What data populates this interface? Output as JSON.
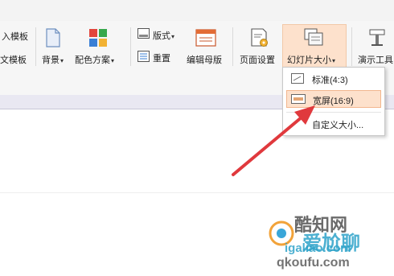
{
  "ribbon": {
    "import_template_partial": "入模板",
    "text_template_partial": "文模板",
    "background": "背景",
    "color_scheme": "配色方案",
    "layout": "版式",
    "reset": "重置",
    "edit_master": "编辑母版",
    "page_setup": "页面设置",
    "slide_size": "幻灯片大小",
    "presentation_tools": "演示工具"
  },
  "slide_size_menu": {
    "items": [
      {
        "label": "标准(4:3)",
        "selected": false
      },
      {
        "label": "宽屏(16:9)",
        "selected": true
      },
      {
        "label": "自定义大小..."
      }
    ]
  },
  "watermark": {
    "line1": "酷知网",
    "line2": "爱尬聊",
    "line3": "igaliao.com",
    "line4": "qkoufu.com"
  },
  "colors": {
    "accent": "#fde1cc",
    "accent_border": "#f2b68e",
    "arrow": "#e0393d"
  }
}
